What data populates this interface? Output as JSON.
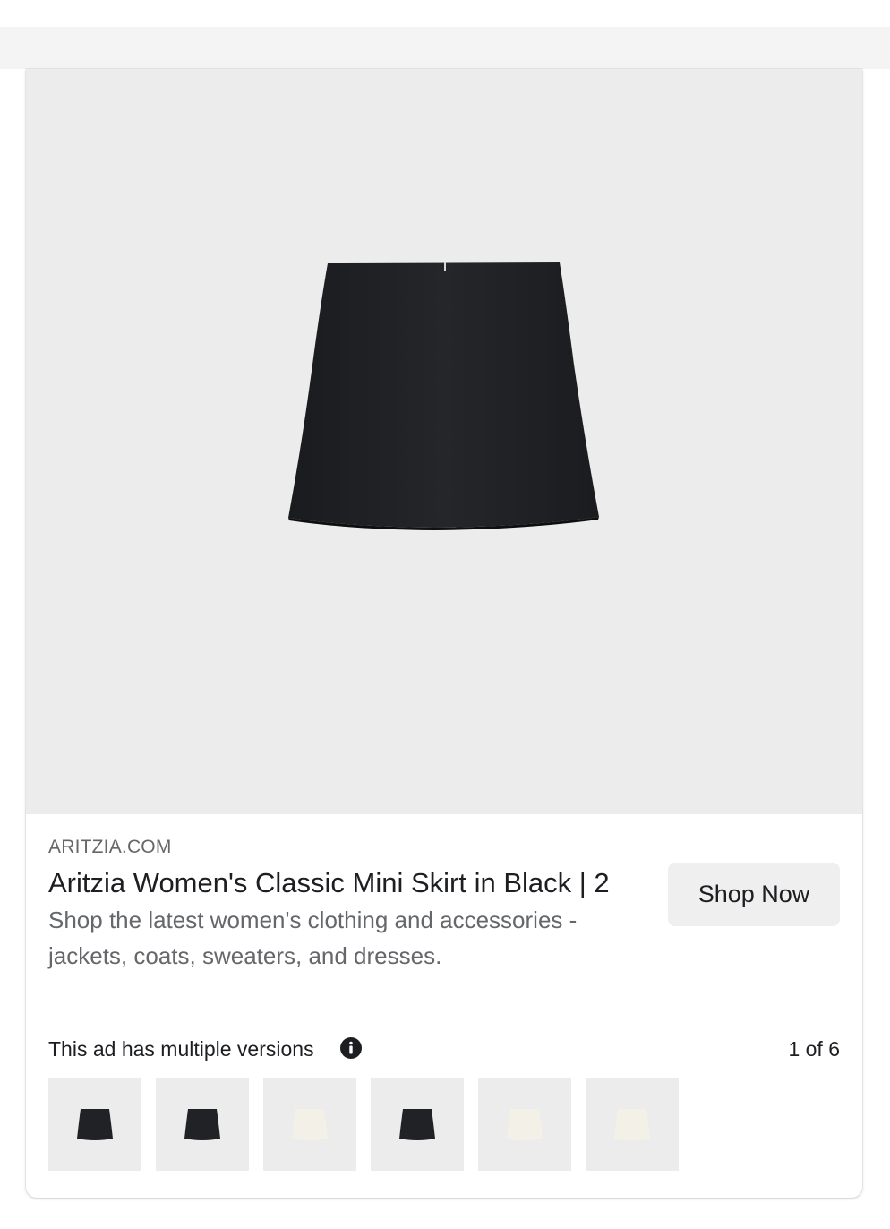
{
  "ad": {
    "domain": "ARITZIA.COM",
    "title": "Aritzia Women's Classic Mini Skirt in Black | 2",
    "description": "Shop the latest women's clothing and accessories - jackets, coats, sweaters, and dresses.",
    "cta_label": "Shop Now",
    "hero_image": "black-mini-skirt-image"
  },
  "versions": {
    "label": "This ad has multiple versions",
    "counter": "1 of 6",
    "info_icon": "info-icon",
    "thumbnails": [
      {
        "color": "#202226",
        "alt": "black-skirt"
      },
      {
        "color": "#202226",
        "alt": "black-skirt"
      },
      {
        "color": "#f3f1e7",
        "alt": "cream-skirt"
      },
      {
        "color": "#202226",
        "alt": "black-skirt"
      },
      {
        "color": "#f3f1e7",
        "alt": "cream-skirt"
      },
      {
        "color": "#f3f1e7",
        "alt": "cream-skirt"
      }
    ]
  },
  "colors": {
    "image_background": "#ececec",
    "skirt_black": "#202226",
    "skirt_cream": "#f3f1e7",
    "button_background": "#efefef",
    "secondary_text": "#65676b",
    "primary_text": "#1c1e21"
  }
}
